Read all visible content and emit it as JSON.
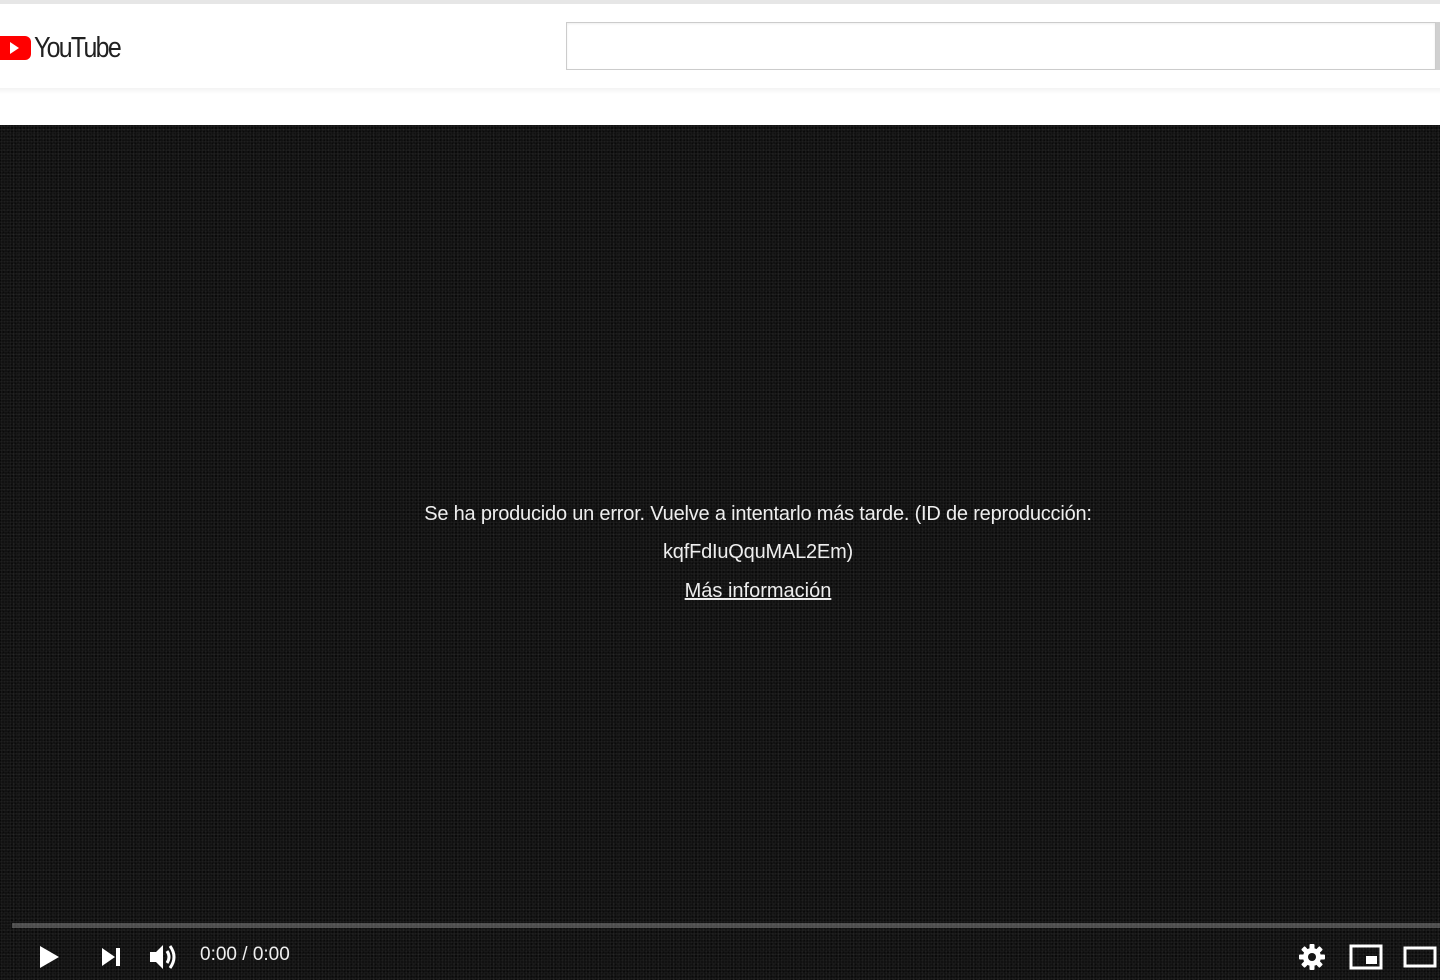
{
  "header": {
    "logo_text": "YouTube",
    "search": {
      "value": "",
      "placeholder": ""
    }
  },
  "player": {
    "error": {
      "message_line1": "Se ha producido un error. Vuelve a intentarlo más tarde. (ID de reproducción:",
      "message_line2": "kqfFdIuQquMAL2Em)",
      "link": "Más información"
    },
    "controls": {
      "current_time": "0:00",
      "separator": "/",
      "duration": "0:00",
      "progress_fraction": 0,
      "icons": [
        "play-icon",
        "next-icon",
        "volume-icon",
        "settings-icon",
        "miniplayer-icon",
        "theater-icon"
      ]
    }
  },
  "colors": {
    "brand_red": "#ff0000",
    "player_background": "#111111",
    "player_text": "#eeeeee"
  }
}
